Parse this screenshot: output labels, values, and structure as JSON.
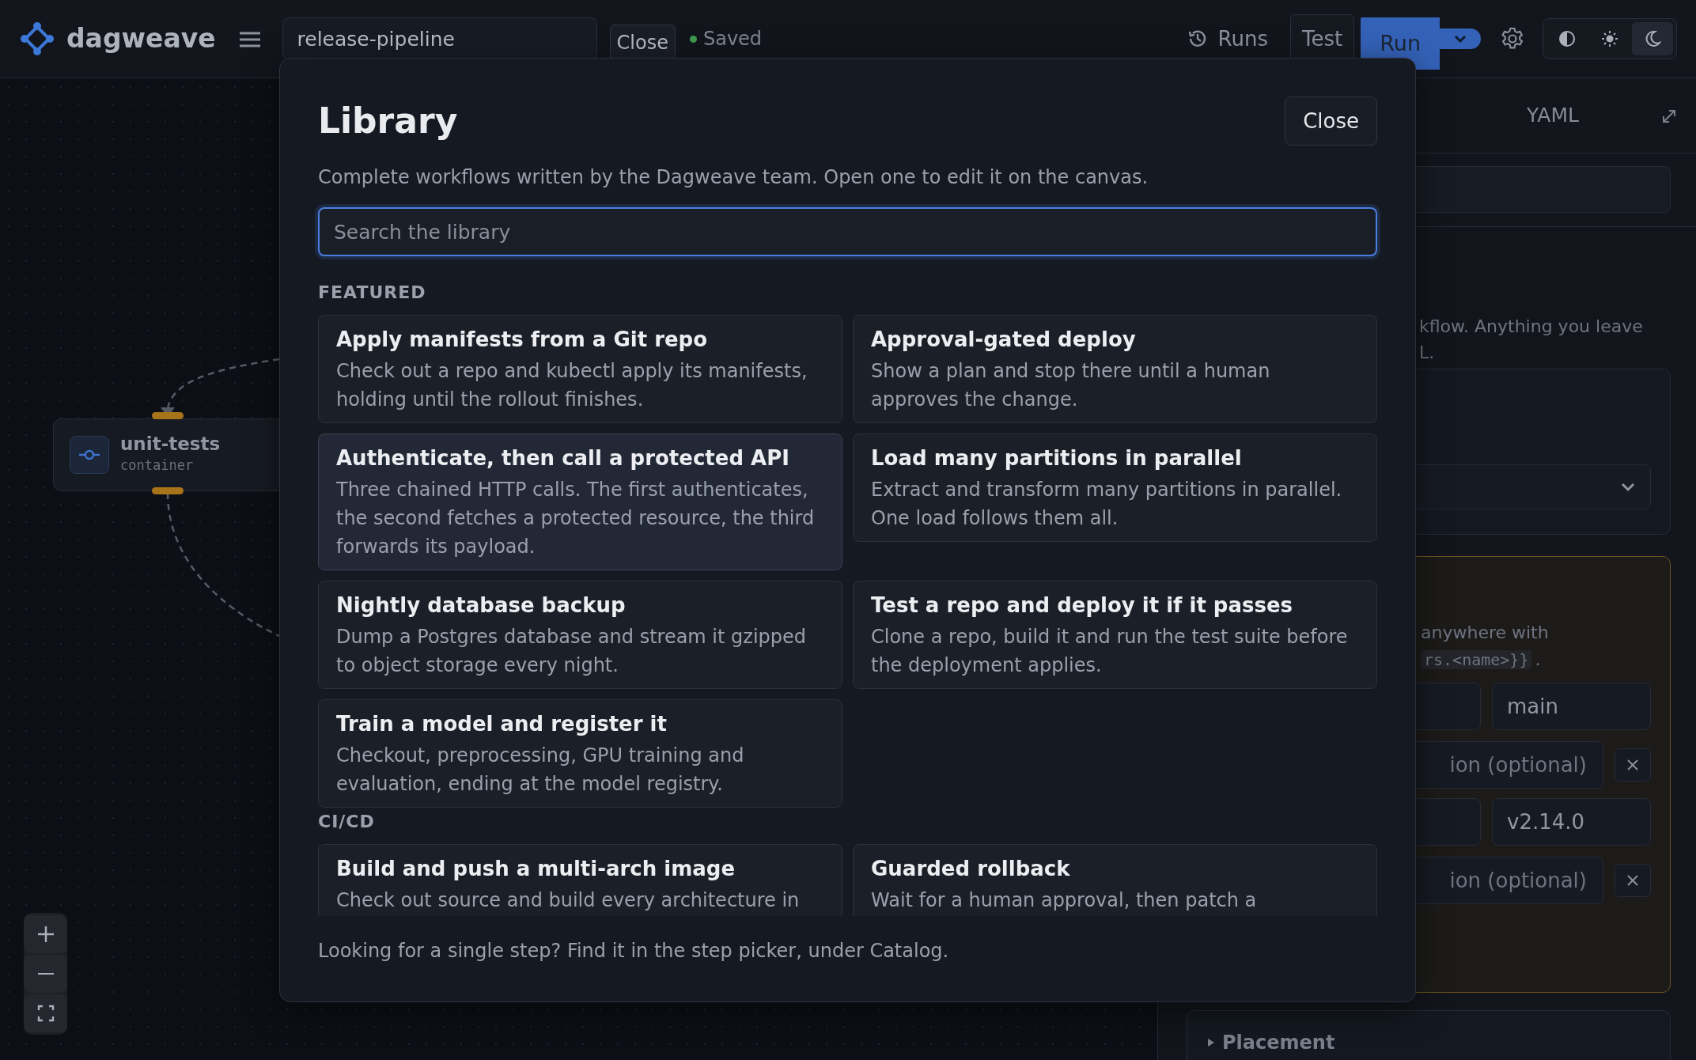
{
  "app": {
    "name": "dagweave"
  },
  "toolbar": {
    "workflow_name": "release-pipeline",
    "close_label": "Close",
    "save_status": "Saved",
    "runs_label": "Runs",
    "test_label": "Test",
    "run_label": "Run",
    "themes": [
      {
        "kind": "auto",
        "selected": false
      },
      {
        "kind": "light",
        "selected": false
      },
      {
        "kind": "dark",
        "selected": true
      }
    ]
  },
  "canvas": {
    "nodes": [
      {
        "name": "unit-tests",
        "type": "container"
      }
    ]
  },
  "side_panel": {
    "tab": "YAML",
    "note_lines": [
      "kflow. Anything you leave",
      "L."
    ],
    "params_hint": "anywhere with",
    "params_code": "rs.<name>}}",
    "params_code_after": ".",
    "params": [
      {
        "value": "main",
        "description_placeholder": "ion (optional)"
      },
      {
        "value": "v2.14.0",
        "description_placeholder": "ion (optional)"
      }
    ],
    "placement_label": "Placement"
  },
  "modal": {
    "title": "Library",
    "close_label": "Close",
    "description": "Complete workflows written by the Dagweave team. Open one to edit it on the canvas.",
    "search_placeholder": "Search the library",
    "sections": [
      {
        "heading": "FEATURED",
        "items": [
          {
            "title": "Apply manifests from a Git repo",
            "description": "Check out a repo and kubectl apply its manifests, holding until the rollout finishes.",
            "highlighted": false
          },
          {
            "title": "Approval-gated deploy",
            "description": "Show a plan and stop there until a human approves the change.",
            "highlighted": false
          },
          {
            "title": "Authenticate, then call a protected API",
            "description": "Three chained HTTP calls. The first authenticates, the second fetches a protected resource, the third forwards its payload.",
            "highlighted": true
          },
          {
            "title": "Load many partitions in parallel",
            "description": "Extract and transform many partitions in parallel. One load follows them all.",
            "highlighted": false
          },
          {
            "title": "Nightly database backup",
            "description": "Dump a Postgres database and stream it gzipped to object storage every night.",
            "highlighted": false
          },
          {
            "title": "Test a repo and deploy it if it passes",
            "description": "Clone a repo, build it and run the test suite before the deployment applies.",
            "highlighted": false
          },
          {
            "title": "Train a model and register it",
            "description": "Checkout, preprocessing, GPU training and evaluation, ending at the model registry.",
            "highlighted": false
          }
        ]
      },
      {
        "heading": "CI/CD",
        "items": [
          {
            "title": "Build and push a multi-arch image",
            "description": "Check out source and build every architecture in",
            "highlighted": false
          },
          {
            "title": "Guarded rollback",
            "description": "Wait for a human approval, then patch a",
            "highlighted": false
          }
        ]
      }
    ],
    "footer": "Looking for a single step? Find it in the step picker, under Catalog."
  }
}
